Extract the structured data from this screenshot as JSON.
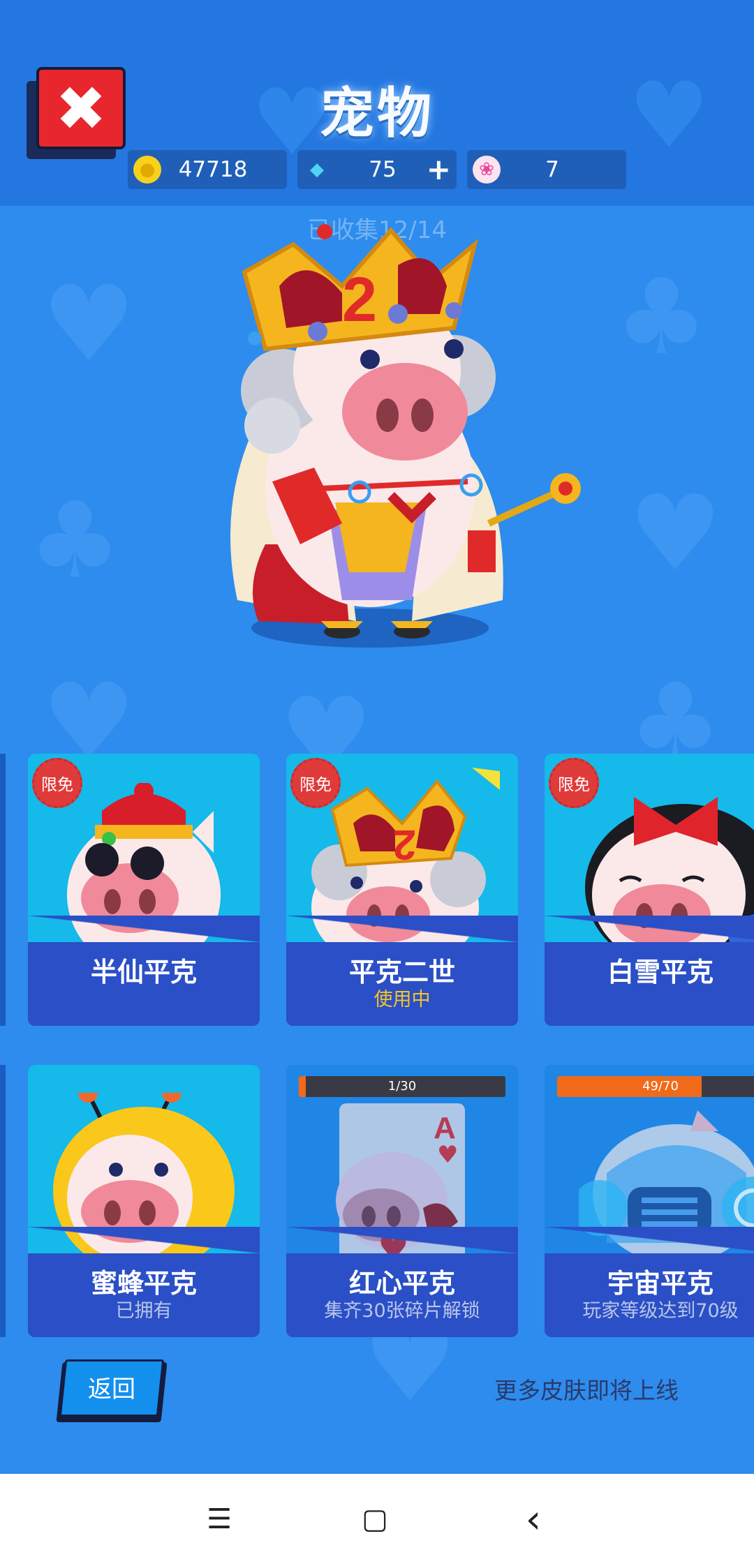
{
  "header": {
    "title": "宠物",
    "close_icon": "close-icon"
  },
  "currencies": [
    {
      "name": "coin",
      "icon": "coin-icon",
      "value": "47718",
      "color": "#f7d21a"
    },
    {
      "name": "diamond",
      "icon": "diamond-icon",
      "value": "75",
      "plus": "+",
      "color": "#4fd4f2"
    },
    {
      "name": "lotus",
      "icon": "lotus-icon",
      "value": "7",
      "color": "#e84a9a"
    }
  ],
  "collected_text": "已收集12/14",
  "skins": [
    {
      "name": "半仙平克",
      "badge": "限免",
      "sub": ""
    },
    {
      "name": "平克二世",
      "badge": "限免",
      "sub": "使用中",
      "sub_color": "#f6c624"
    },
    {
      "name": "白雪平克",
      "badge": "限免",
      "sub": ""
    },
    {
      "name": "蜜蜂平克",
      "sub": "已拥有",
      "sub_color": "#b9c6e8"
    },
    {
      "name": "红心平克",
      "sub": "集齐30张碎片解锁",
      "sub_color": "#b9c6e8",
      "progress_text": "1/30",
      "progress": 0.033
    },
    {
      "name": "宇宙平克",
      "sub": "玩家等级达到70级",
      "sub_color": "#b9c6e8",
      "progress_text": "49/70",
      "progress": 0.7
    }
  ],
  "footer": {
    "back_label": "返回",
    "more_text": "更多皮肤即将上线"
  },
  "navbar": {
    "menu_glyph": "☰",
    "home_glyph": "▢",
    "back_glyph": "‹"
  }
}
